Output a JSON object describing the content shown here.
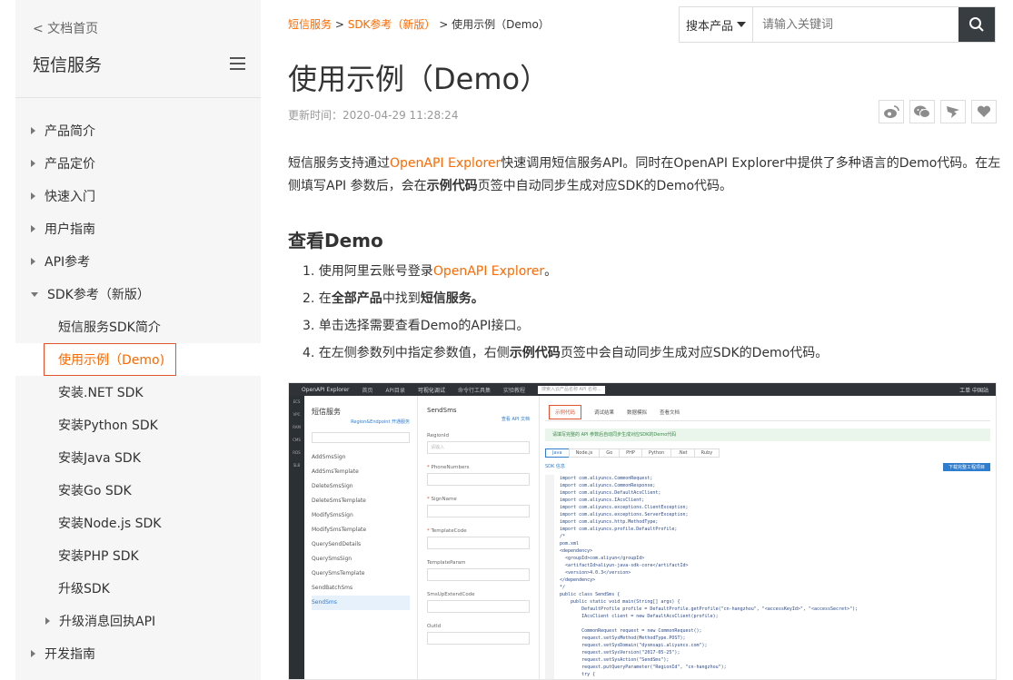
{
  "sidebar": {
    "back": "< 文档首页",
    "title": "短信服务",
    "items": [
      {
        "label": "产品简介"
      },
      {
        "label": "产品定价"
      },
      {
        "label": "快速入门"
      },
      {
        "label": "用户指南"
      },
      {
        "label": "API参考"
      },
      {
        "label": "SDK参考（新版）"
      },
      {
        "label": "短信服务SDK简介"
      },
      {
        "label": "使用示例（Demo)"
      },
      {
        "label": "安装.NET SDK"
      },
      {
        "label": "安装Python SDK"
      },
      {
        "label": "安装Java SDK"
      },
      {
        "label": "安装Go SDK"
      },
      {
        "label": "安装Node.js SDK"
      },
      {
        "label": "安装PHP SDK"
      },
      {
        "label": "升级SDK"
      },
      {
        "label": "升级消息回执API"
      },
      {
        "label": "开发指南"
      }
    ]
  },
  "breadcrumb": {
    "l1": "短信服务",
    "sep1": " > ",
    "l2": "SDK参考（新版）",
    "sep2": " > ",
    "current": "使用示例（Demo）"
  },
  "search": {
    "product": "搜本产品",
    "placeholder": "请输入关键词"
  },
  "page": {
    "title": "使用示例（Demo）",
    "updated": "更新时间：2020-04-29 11:28:24",
    "para_1": "短信服务支持通过",
    "para_link": "OpenAPI Explorer",
    "para_2": "快速调用短信服务API。同时在OpenAPI Explorer中提供了多种语言的Demo代码。在左侧填写API 参数后，会在",
    "para_bold": "示例代码",
    "para_3": "页签中自动同步生成对应SDK的Demo代码。",
    "section": "查看Demo",
    "steps": {
      "s1a": "1. 使用阿里云账号登录",
      "s1link": "OpenAPI Explorer",
      "s1b": "。",
      "s2a": "2. 在",
      "s2b": "全部产品",
      "s2c": "中找到",
      "s2d": "短信服务。",
      "s3": "3. 单击选择需要查看Demo的API接口。",
      "s4a": "4. 在左侧参数列中指定参数值，右侧",
      "s4b": "示例代码",
      "s4c": "页签中会自动同步生成对应SDK的Demo代码。"
    }
  },
  "screenshot": {
    "brand": "OpenAPI Explorer",
    "nav": [
      "首页",
      "API目录",
      "可视化调试",
      "命令行工具集",
      "实验教程"
    ],
    "search": "搜索入云产品名称 API 名称...",
    "right": "工单   中国站",
    "rail": [
      "ECS",
      "VPC",
      "RAM",
      "CMS",
      "RDS",
      "SLB"
    ],
    "product": "短信服务",
    "meta": "Region&Endpoint 开通服务",
    "apis": [
      "AddSmsSign",
      "AddSmsTemplate",
      "DeleteSmsSign",
      "DeleteSmsTemplate",
      "ModifySmsSign",
      "ModifySmsTemplate",
      "QuerySendDetails",
      "QuerySmsSign",
      "QuerySmsTemplate",
      "SendBatchSms",
      "SendSms"
    ],
    "api_title": "SendSms",
    "api_doc": "查看 API 文档",
    "fields": [
      {
        "label": "RegionId",
        "req": "",
        "value": "请输入"
      },
      {
        "label": "PhoneNumbers",
        "req": "*",
        "value": ""
      },
      {
        "label": "SignName",
        "req": "*",
        "value": ""
      },
      {
        "label": "TemplateCode",
        "req": "*",
        "value": ""
      },
      {
        "label": "TemplateParam",
        "req": "",
        "value": ""
      },
      {
        "label": "SmsUpExtendCode",
        "req": "",
        "value": ""
      },
      {
        "label": "OutId",
        "req": "",
        "value": ""
      }
    ],
    "tabs": [
      "示例代码",
      "调试结果",
      "数据模拟",
      "查看文档"
    ],
    "note": "请填写完整的 API 参数后自动同步生成对应SDK的Demo代码",
    "langs": [
      "Java",
      "Node.js",
      "Go",
      "PHP",
      "Python",
      ".Net",
      "Ruby"
    ],
    "sdk_info": "SDK 信息",
    "download": "下载完整工程项目",
    "code": "import com.aliyuncs.CommonRequest;\nimport com.aliyuncs.CommonResponse;\nimport com.aliyuncs.DefaultAcsClient;\nimport com.aliyuncs.IAcsClient;\nimport com.aliyuncs.exceptions.ClientException;\nimport com.aliyuncs.exceptions.ServerException;\nimport com.aliyuncs.http.MethodType;\nimport com.aliyuncs.profile.DefaultProfile;\n/*\npom.xml\n<dependency>\n  <groupId>com.aliyun</groupId>\n  <artifactId>aliyun-java-sdk-core</artifactId>\n  <version>4.0.3</version>\n</dependency>\n*/\npublic class SendSms {\n    public static void main(String[] args) {\n        DefaultProfile profile = DefaultProfile.getProfile(\"cn-hangzhou\", \"<accessKeyId>\", \"<accessSecret>\");\n        IAcsClient client = new DefaultAcsClient(profile);\n\n        CommonRequest request = new CommonRequest();\n        request.setSysMethod(MethodType.POST);\n        request.setSysDomain(\"dysmsapi.aliyuncs.com\");\n        request.setSysVersion(\"2017-05-25\");\n        request.setSysAction(\"SendSms\");\n        request.putQueryParameter(\"RegionId\", \"cn-hangzhou\");\n        try {\n            CommonResponse response = client.getCommonResponse(request);"
  },
  "colors": {
    "accent": "#ff6a00",
    "sidebar_bg": "#f6f6f6",
    "search_button": "#373d41"
  }
}
